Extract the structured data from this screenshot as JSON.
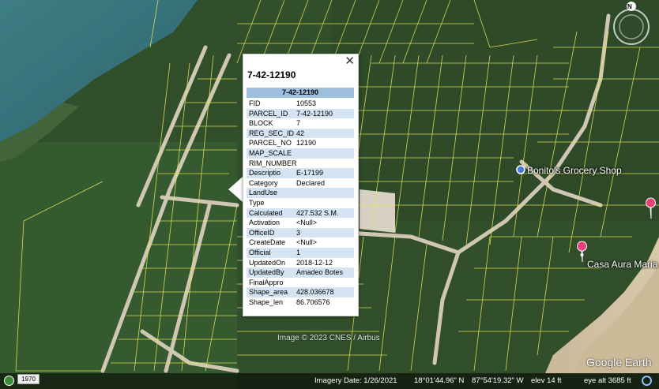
{
  "popup": {
    "title": "7-42-12190",
    "table_header": "7-42-12190",
    "close_glyph": "✕",
    "fields": [
      {
        "k": "FID",
        "v": "10553"
      },
      {
        "k": "PARCEL_ID",
        "v": "7-42-12190"
      },
      {
        "k": "BLOCK",
        "v": "7"
      },
      {
        "k": "REG_SEC_ID",
        "v": "42"
      },
      {
        "k": "PARCEL_NO",
        "v": "12190"
      },
      {
        "k": "MAP_SCALE",
        "v": ""
      },
      {
        "k": "RIM_NUMBER",
        "v": ""
      },
      {
        "k": "Descriptio",
        "v": "E-17199"
      },
      {
        "k": "Category",
        "v": "Declared"
      },
      {
        "k": "LandUse",
        "v": ""
      },
      {
        "k": "Type",
        "v": ""
      },
      {
        "k": "Calculated",
        "v": "427.532 S.M."
      },
      {
        "k": "Activation",
        "v": "<Null>"
      },
      {
        "k": "OfficeID",
        "v": "3"
      },
      {
        "k": "CreateDate",
        "v": "<Null>"
      },
      {
        "k": "Official",
        "v": "1"
      },
      {
        "k": "UpdatedOn",
        "v": "2018-12-12"
      },
      {
        "k": "UpdatedBy",
        "v": "Amadeo Botes"
      },
      {
        "k": "FinalAppro",
        "v": ""
      },
      {
        "k": "Shape_area",
        "v": "428.036678"
      },
      {
        "k": "Shape_len",
        "v": "86.706576"
      }
    ]
  },
  "places": {
    "grocery": "Bonito's Grocery Shop",
    "casa": "Casa Aura Maria"
  },
  "credit": "Image © 2023 CNES / Airbus",
  "logo": "Google Earth",
  "compass_letter": "N",
  "status": {
    "year": "1970",
    "imagery_date": "Imagery Date: 1/26/2021",
    "lat": "18°01'44.96\" N",
    "lon": "87°54'19.32\" W",
    "elev": "elev   14 ft",
    "eye_alt": "eye alt  3685 ft"
  },
  "colors": {
    "parcel_lines": "#e6e65a",
    "water": "#3f7f86",
    "forest": "#2f4f2a",
    "popup_header": "#9fbfdf",
    "pin": "#e8427a"
  }
}
